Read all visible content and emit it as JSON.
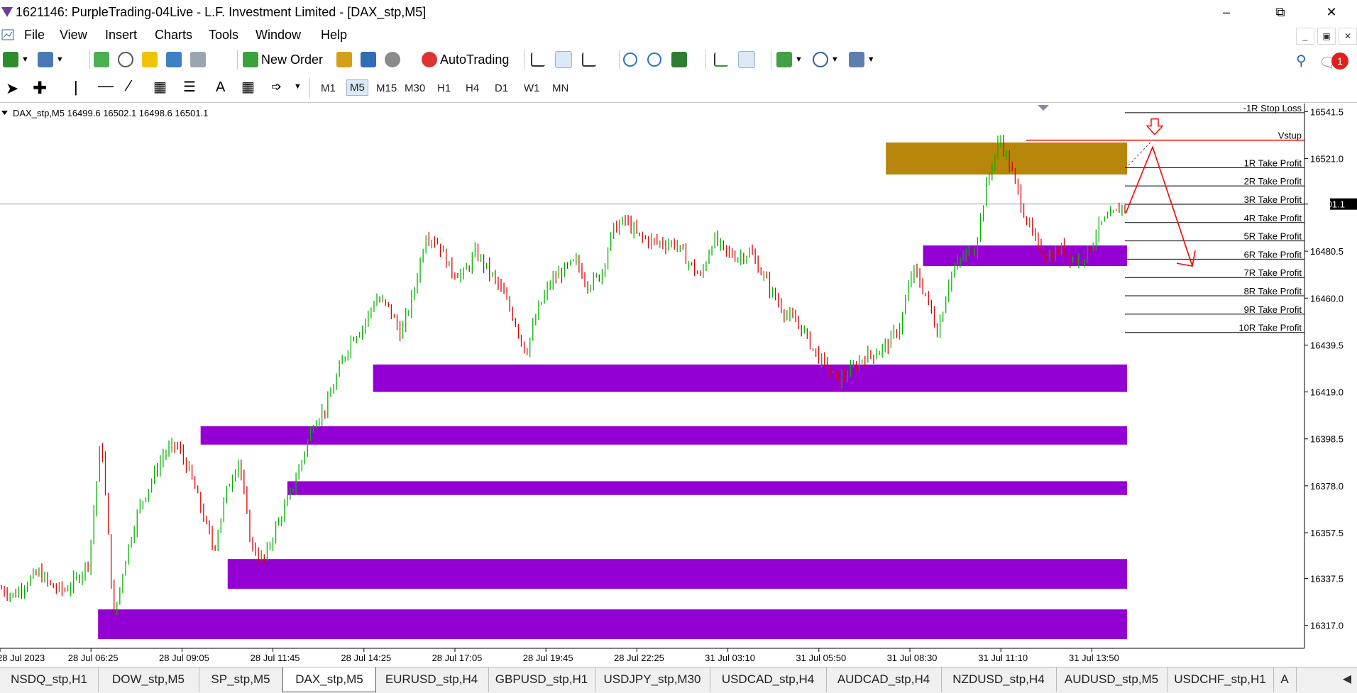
{
  "window": {
    "title": "1621146: PurpleTrading-04Live - L.F. Investment Limited - [DAX_stp,M5]",
    "minimize": "–",
    "maximize": "⧉",
    "close": "✕"
  },
  "menu": [
    "File",
    "View",
    "Insert",
    "Charts",
    "Tools",
    "Window",
    "Help"
  ],
  "toolbar": {
    "new_order": "New Order",
    "autotrading": "AutoTrading",
    "notifications": "1"
  },
  "timeframes": [
    "M1",
    "M5",
    "M15",
    "M30",
    "H1",
    "H4",
    "D1",
    "W1",
    "MN"
  ],
  "active_timeframe": "M5",
  "chart_header": "DAX_stp,M5  16499.6 16502.1 16498.6 16501.1",
  "chart_data": {
    "type": "candlestick",
    "symbol": "DAX_stp",
    "timeframe": "M5",
    "ohlc_last": {
      "open": 16499.6,
      "high": 16502.1,
      "low": 16498.6,
      "close": 16501.1
    },
    "current_price": "16501.1",
    "ylim": [
      16307,
      16545
    ],
    "y_ticks": [
      "16541.5",
      "16521.0",
      "16501.1",
      "16480.5",
      "16460.0",
      "16439.5",
      "16419.0",
      "16398.5",
      "16378.0",
      "16357.5",
      "16337.5",
      "16317.0"
    ],
    "x_ticks": [
      "28 Jul 2023",
      "28 Jul 06:25",
      "28 Jul 09:05",
      "28 Jul 11:45",
      "28 Jul 14:25",
      "28 Jul 17:05",
      "28 Jul 19:45",
      "28 Jul 22:25",
      "31 Jul 03:10",
      "31 Jul 05:50",
      "31 Jul 08:30",
      "31 Jul 11:10",
      "31 Jul 13:50"
    ],
    "price_path": [
      16333,
      16330,
      16336,
      16340,
      16334,
      16332,
      16337,
      16345,
      16400,
      16320,
      16348,
      16368,
      16380,
      16392,
      16396,
      16385,
      16368,
      16350,
      16375,
      16390,
      16352,
      16345,
      16360,
      16372,
      16388,
      16406,
      16412,
      16428,
      16442,
      16448,
      16460,
      16456,
      16444,
      16462,
      16488,
      16484,
      16472,
      16470,
      16480,
      16472,
      16464,
      16452,
      16436,
      16455,
      16467,
      16472,
      16476,
      16466,
      16470,
      16490,
      16494,
      16487,
      16485,
      16484,
      16484,
      16476,
      16469,
      16486,
      16480,
      16478,
      16480,
      16470,
      16460,
      16452,
      16448,
      16438,
      16430,
      16424,
      16428,
      16434,
      16436,
      16440,
      16448,
      16473,
      16462,
      16445,
      16470,
      16478,
      16482,
      16512,
      16530,
      16514,
      16496,
      16482,
      16478,
      16482,
      16476,
      16480,
      16492,
      16496,
      16501
    ],
    "zones": [
      {
        "type": "demand",
        "top": 16431,
        "bottom": 16419,
        "from": 0.331,
        "color": "#9400d3"
      },
      {
        "type": "demand",
        "top": 16404,
        "bottom": 16396,
        "from": 0.178,
        "color": "#9400d3"
      },
      {
        "type": "demand",
        "top": 16380,
        "bottom": 16374,
        "from": 0.255,
        "color": "#9400d3"
      },
      {
        "type": "demand",
        "top": 16346,
        "bottom": 16333,
        "from": 0.202,
        "color": "#9400d3"
      },
      {
        "type": "demand",
        "top": 16324,
        "bottom": 16311,
        "from": 0.087,
        "color": "#9400d3"
      },
      {
        "type": "demand",
        "top": 16483,
        "bottom": 16474,
        "from": 0.819,
        "color": "#9400d3"
      },
      {
        "type": "supply",
        "top": 16528,
        "bottom": 16514,
        "from": 0.786,
        "color": "#b8860b"
      }
    ],
    "rr_levels": [
      {
        "label": "-1R Stop Loss",
        "price": 16541
      },
      {
        "label": "Vstup",
        "price": 16529
      },
      {
        "label": "1R Take Profit",
        "price": 16517
      },
      {
        "label": "2R Take Profit",
        "price": 16509
      },
      {
        "label": "3R Take Profit",
        "price": 16501
      },
      {
        "label": "4R Take Profit",
        "price": 16493
      },
      {
        "label": "5R Take Profit",
        "price": 16485
      },
      {
        "label": "6R Take Profit",
        "price": 16477
      },
      {
        "label": "7R Take Profit",
        "price": 16469
      },
      {
        "label": "8R Take Profit",
        "price": 16461
      },
      {
        "label": "9R Take Profit",
        "price": 16453
      },
      {
        "label": "10R Take Profit",
        "price": 16445
      }
    ],
    "colors": {
      "bull": "#00b400",
      "bear": "#e00000",
      "grid": "#cccccc",
      "arrow": "#ff0000"
    }
  },
  "tabs": [
    "NSDQ_stp,H1",
    "DOW_stp,M5",
    "SP_stp,M5",
    "DAX_stp,M5",
    "EURUSD_stp,H4",
    "GBPUSD_stp,H1",
    "USDJPY_stp,M30",
    "USDCAD_stp,H4",
    "AUDCAD_stp,H4",
    "NZDUSD_stp,H4",
    "AUDUSD_stp,M5",
    "USDCHF_stp,H1",
    "A"
  ],
  "active_tab": "DAX_stp,M5"
}
